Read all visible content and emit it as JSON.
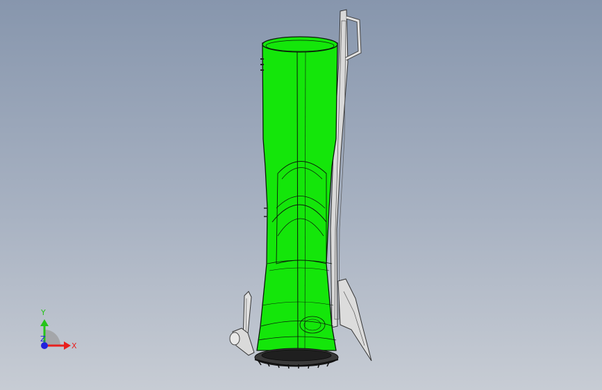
{
  "viewport": {
    "background_top": "#8796ad",
    "background_bottom": "#c7ccd4"
  },
  "model": {
    "boot_color": "#14e60a",
    "outline_color": "#0a1a0a",
    "sole_color": "#3a3a3a",
    "accessory_color": "#d6d6d6"
  },
  "triad": {
    "x_label": "X",
    "y_label": "Y",
    "z_label": "Z",
    "x_color": "#e8201e",
    "y_color": "#26c41a",
    "z_color": "#2222dd"
  }
}
